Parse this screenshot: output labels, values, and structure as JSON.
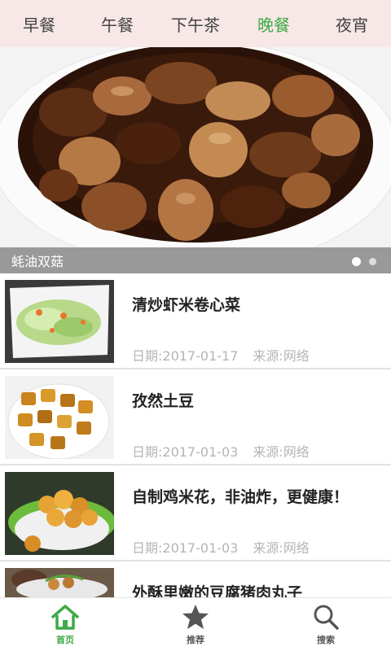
{
  "tabs": [
    {
      "label": "早餐"
    },
    {
      "label": "午餐"
    },
    {
      "label": "下午茶"
    },
    {
      "label": "晚餐",
      "active": true
    },
    {
      "label": "夜宵"
    }
  ],
  "banner": {
    "caption": "蚝油双菇",
    "image": "braised-mushrooms-dish",
    "page_count": 2,
    "active_page": 1
  },
  "recipes": [
    {
      "title": "清炒虾米卷心菜",
      "date": "日期:2017-01-17",
      "source": "来源:网络",
      "image": "stir-fried-cabbage"
    },
    {
      "title": "孜然土豆",
      "date": "日期:2017-01-03",
      "source": "来源:网络",
      "image": "cumin-potatoes"
    },
    {
      "title": "自制鸡米花，非油炸，更健康！",
      "date": "日期:2017-01-03",
      "source": "来源:网络",
      "image": "popcorn-chicken"
    },
    {
      "title": "外酥里嫩的豆腐猪肉丸子",
      "date": "",
      "source": "",
      "image": "tofu-pork-balls"
    }
  ],
  "bottom_nav": [
    {
      "label": "首页",
      "icon": "home-icon",
      "active": true
    },
    {
      "label": "推荐",
      "icon": "star-icon"
    },
    {
      "label": "搜索",
      "icon": "search-icon"
    }
  ],
  "colors": {
    "accent": "#3eaa48",
    "tabbar_bg": "#f7e7e6",
    "meta_text": "#b5b5b5",
    "nav_icon": "#555555"
  }
}
